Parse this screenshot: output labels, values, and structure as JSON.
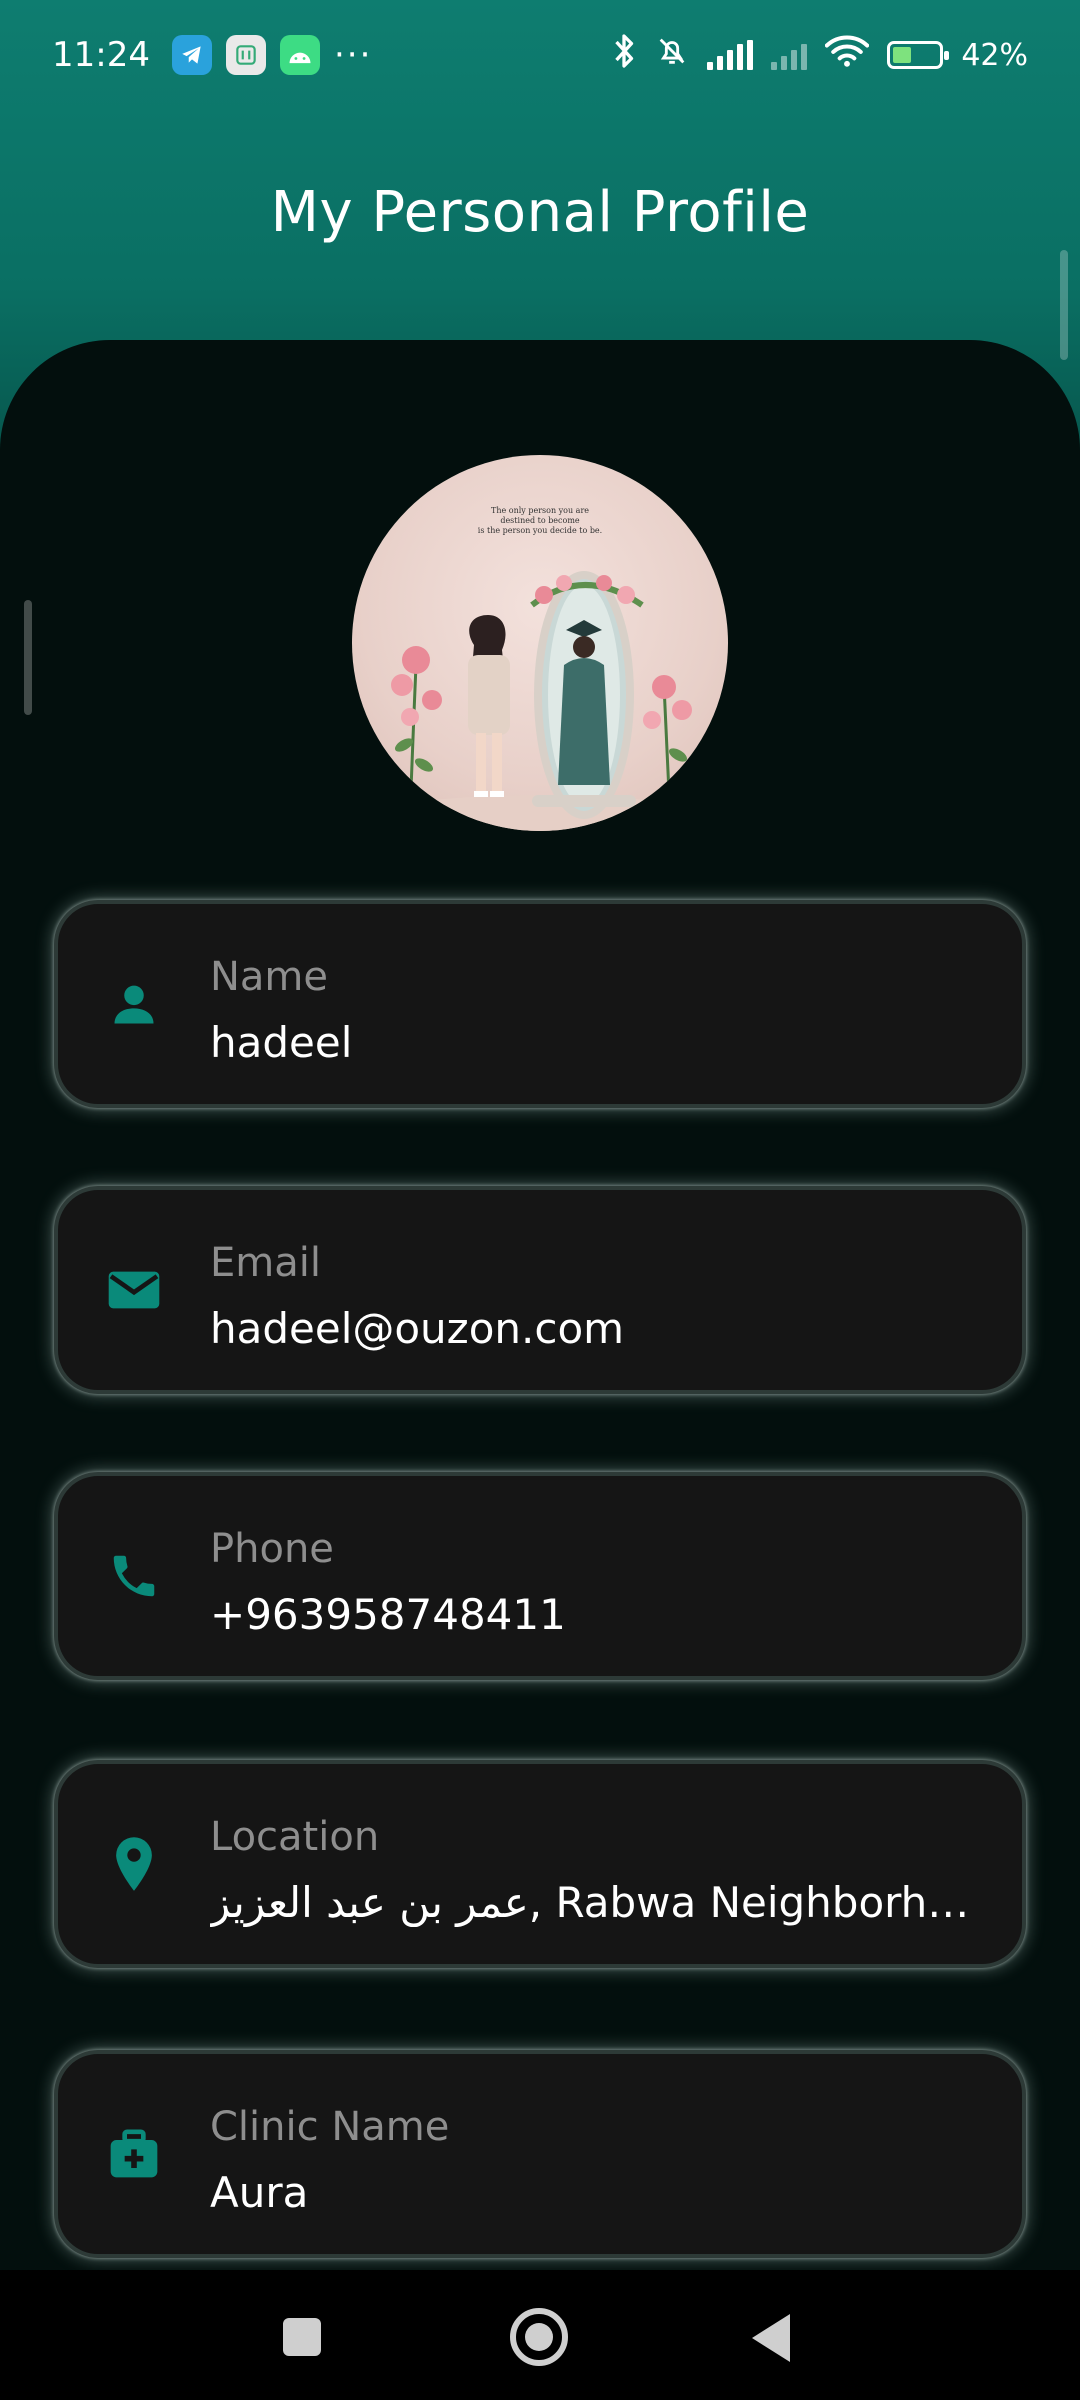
{
  "status_bar": {
    "time": "11:24",
    "battery_percent": "42%",
    "battery_level": 0.42,
    "icons": [
      "telegram-icon",
      "grid-app-icon",
      "android-icon",
      "more-dots-icon",
      "bluetooth-icon",
      "bell-off-icon",
      "signal-icon",
      "signal-weak-icon",
      "wifi-icon",
      "battery-charging-icon"
    ],
    "more_dots": "···"
  },
  "app_bar": {
    "title": "My Personal Profile"
  },
  "profile": {
    "avatar_icon": "profile-photo",
    "avatar_caption": [
      "The only person you are",
      "destined to become",
      "is the person you decide to be."
    ],
    "fields": [
      {
        "label": "Name",
        "value": "hadeel",
        "icon": "person-icon"
      },
      {
        "label": "Email",
        "value": "hadeel@ouzon.com",
        "icon": "mail-icon"
      },
      {
        "label": "Phone",
        "value": "+963958748411",
        "icon": "phone-icon"
      },
      {
        "label": "Location",
        "value": "عمر بن عبد العزيز, Rabwa Neighborhood, Damascus",
        "icon": "location-pin-icon"
      },
      {
        "label": "Clinic Name",
        "value": "Aura",
        "icon": "medical-bag-icon"
      }
    ]
  },
  "colors": {
    "accent": "#0a7d6e",
    "header": "#0b7a6c",
    "panel": "#030f0d",
    "card": "#151515",
    "label": "#8e8e8e",
    "value": "#ffffff"
  },
  "nav_bar": {
    "icons": [
      "recent-apps-icon",
      "home-icon",
      "back-icon"
    ]
  }
}
